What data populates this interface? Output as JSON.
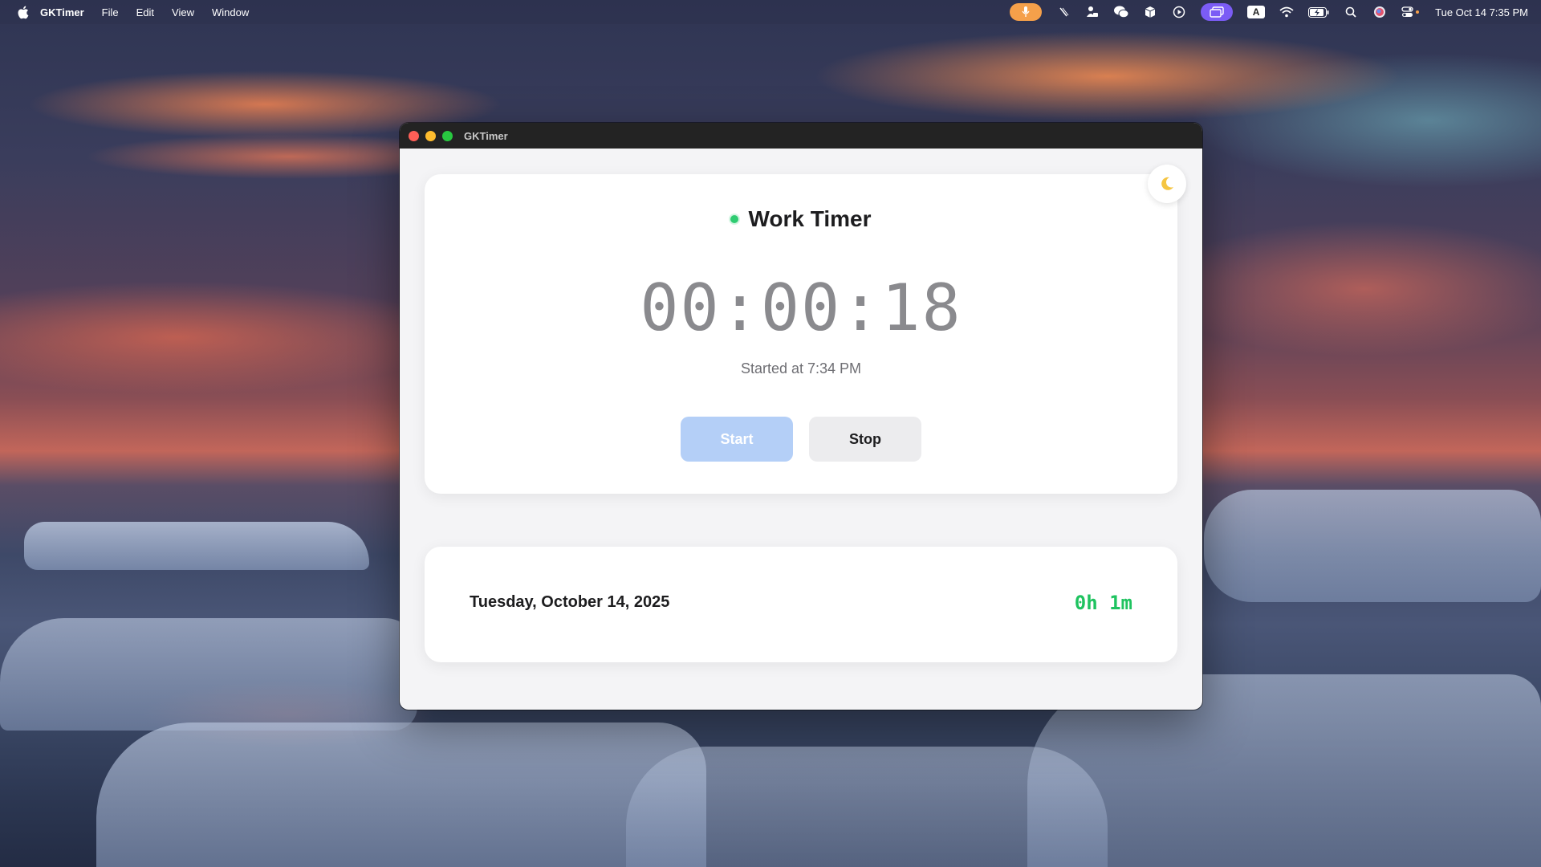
{
  "menubar": {
    "app_name": "GKTimer",
    "items": [
      "File",
      "Edit",
      "View",
      "Window"
    ],
    "status_icons": [
      "microphone-icon",
      "slash-icon",
      "lock-person-icon",
      "wechat-icon",
      "cube-icon",
      "play-circle-icon",
      "screen-mirror-icon",
      "input-source-icon",
      "wifi-icon",
      "battery-icon",
      "search-icon",
      "siri-icon",
      "control-center-icon"
    ],
    "input_source": "A",
    "clock": "Tue Oct 14  7:35 PM"
  },
  "window": {
    "title": "GKTimer"
  },
  "timer": {
    "label": "Work Timer",
    "status_color": "#2ecc71",
    "display": "00:00:18",
    "started_at": "Started at 7:34 PM",
    "start_label": "Start",
    "stop_label": "Stop",
    "theme_toggle_icon": "moon-icon"
  },
  "summary": {
    "date": "Tuesday, October 14, 2025",
    "total": "0h 1m",
    "total_color": "#1fc360"
  },
  "colors": {
    "accent_disabled": "#b4cff7",
    "traffic_red": "#ff5f57",
    "traffic_yellow": "#febc2e",
    "traffic_green": "#28c840"
  }
}
